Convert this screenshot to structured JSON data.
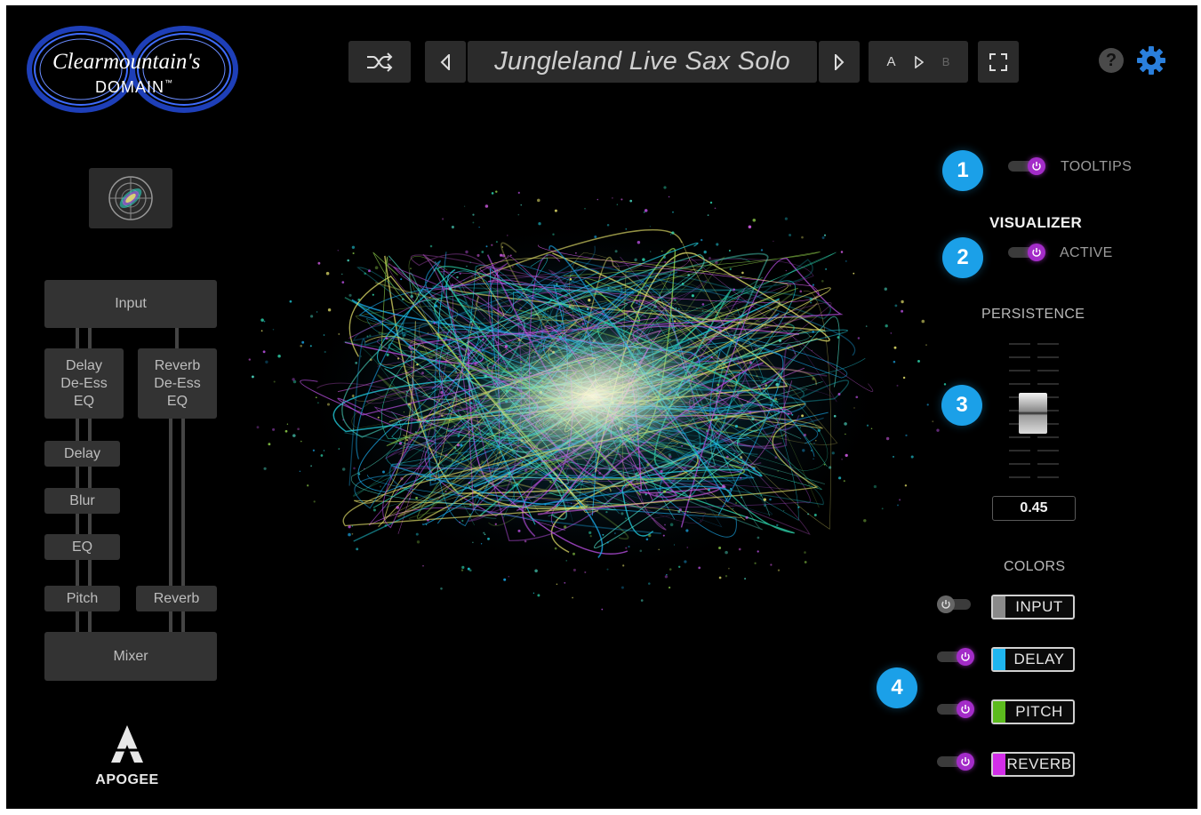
{
  "header": {
    "brand_line1": "Clearmountain's",
    "brand_line2": "DOMAIN",
    "trademark": "™",
    "preset_name": "Jungleland Live Sax Solo",
    "ab_a": "A",
    "ab_b": "B"
  },
  "signal_flow": {
    "input": "Input",
    "delay_chain_header": "Delay\nDe-Ess\nEQ",
    "reverb_chain_header": "Reverb\nDe-Ess\nEQ",
    "delay": "Delay",
    "blur": "Blur",
    "eq": "EQ",
    "pitch": "Pitch",
    "reverb": "Reverb",
    "mixer": "Mixer"
  },
  "footer": {
    "brand": "APOGEE"
  },
  "right_panel": {
    "badges": [
      "1",
      "2",
      "3",
      "4"
    ],
    "tooltips_label": "TOOLTIPS",
    "tooltips_on": true,
    "visualizer_title": "VISUALIZER",
    "active_label": "ACTIVE",
    "active_on": true,
    "persistence_label": "PERSISTENCE",
    "persistence_value": "0.45",
    "persistence_level": 0.45,
    "colors_title": "COLORS",
    "colors": [
      {
        "label": "INPUT",
        "swatch": "#8a8a8a",
        "on": false
      },
      {
        "label": "DELAY",
        "swatch": "#1fb6f0",
        "on": true
      },
      {
        "label": "PITCH",
        "swatch": "#5cbb1e",
        "on": true
      },
      {
        "label": "REVERB",
        "swatch": "#d22ee8",
        "on": true
      }
    ]
  },
  "theme": {
    "accent": "#1ba0e8",
    "toggle_on": "#a32cc8"
  }
}
